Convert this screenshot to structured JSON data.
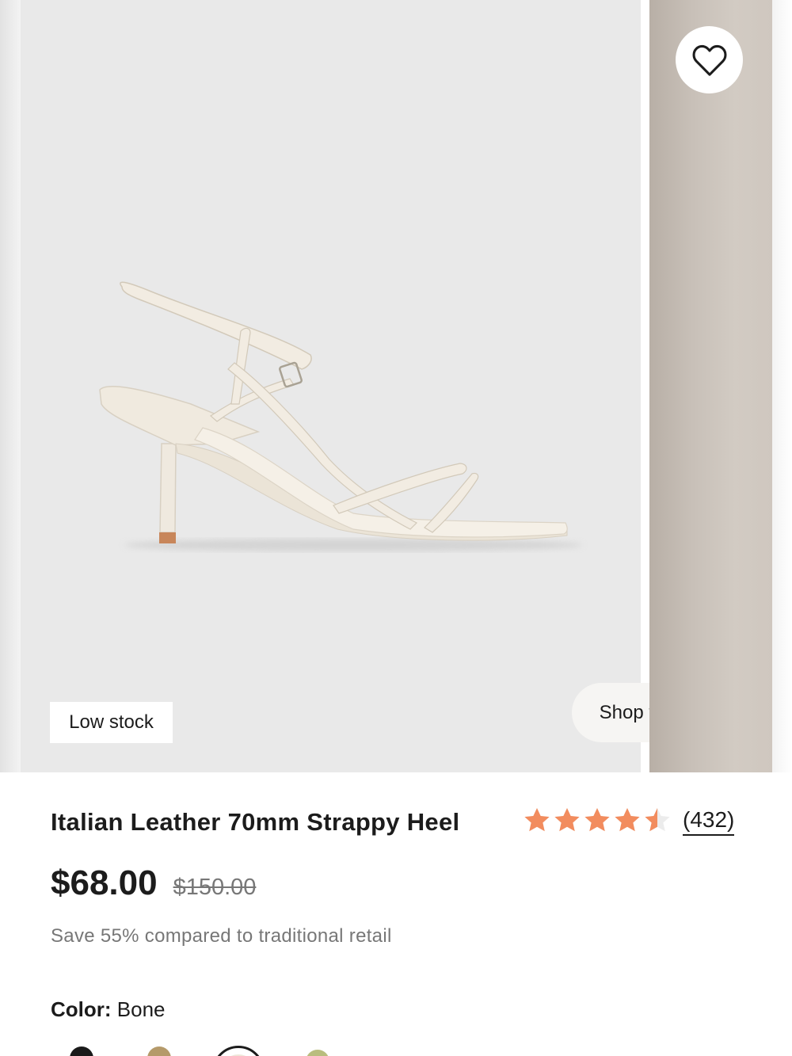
{
  "gallery": {
    "badge": "Low stock",
    "shop_the_look": "Shop the look",
    "favorite_icon": "heart-outline-icon"
  },
  "product": {
    "name": "Italian Leather 70mm Strappy Heel",
    "rating": 4.5,
    "rating_max": 5,
    "star_color": "#F28C5E",
    "review_count": "(432)",
    "price": "$68.00",
    "original_price": "$150.00",
    "savings_text": "Save 55% compared to traditional retail",
    "color_label": "Color:",
    "color_value": "Bone",
    "swatches": [
      {
        "name": "Black",
        "hex": "#1a1a1a",
        "selected": false
      },
      {
        "name": "Tan",
        "hex": "#b59a6a",
        "selected": false
      },
      {
        "name": "Bone",
        "hex": "#eee6d8",
        "selected": true
      },
      {
        "name": "Olive",
        "hex": "#b9bd7e",
        "selected": false
      }
    ]
  }
}
